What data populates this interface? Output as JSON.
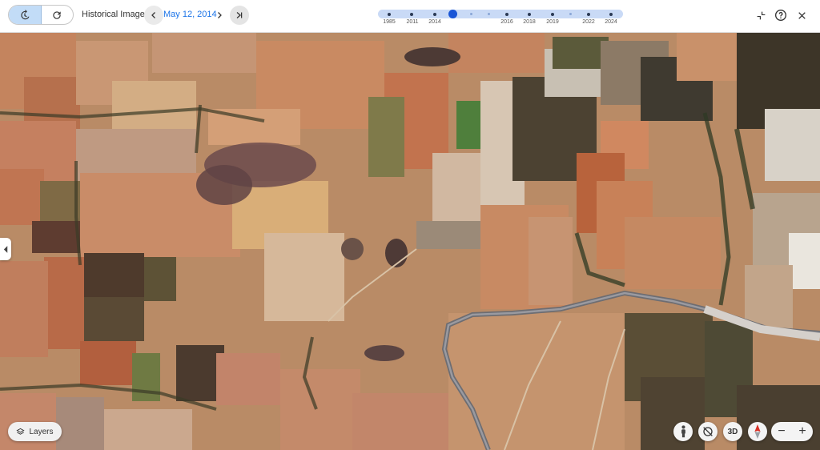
{
  "toolbar": {
    "title": "Historical Imagery",
    "date": "May 12, 2014"
  },
  "timeline": {
    "years": [
      "1985",
      "2011",
      "2014",
      "2016",
      "2018",
      "2019",
      "2022",
      "2024"
    ],
    "selected_year": "2014"
  },
  "bottom": {
    "layers_label": "Layers",
    "three_d_label": "3D",
    "zoom_out_label": "−",
    "zoom_in_label": "+"
  },
  "icons": {
    "back_in_time": "history-icon",
    "refresh": "refresh-icon",
    "prev": "chevron-left-icon",
    "next": "chevron-right-icon",
    "latest": "skip-to-end-icon",
    "collapse": "collapse-icon",
    "help": "help-icon",
    "close": "close-icon",
    "pegman": "pegman-icon",
    "tilt": "tilt-icon",
    "compass": "compass-icon",
    "layers": "layers-icon"
  },
  "colors": {
    "accent": "#1a73e8",
    "timeline_track": "#c9daf6",
    "knob": "#1a56d6",
    "active_segment": "#c2dcf7"
  }
}
